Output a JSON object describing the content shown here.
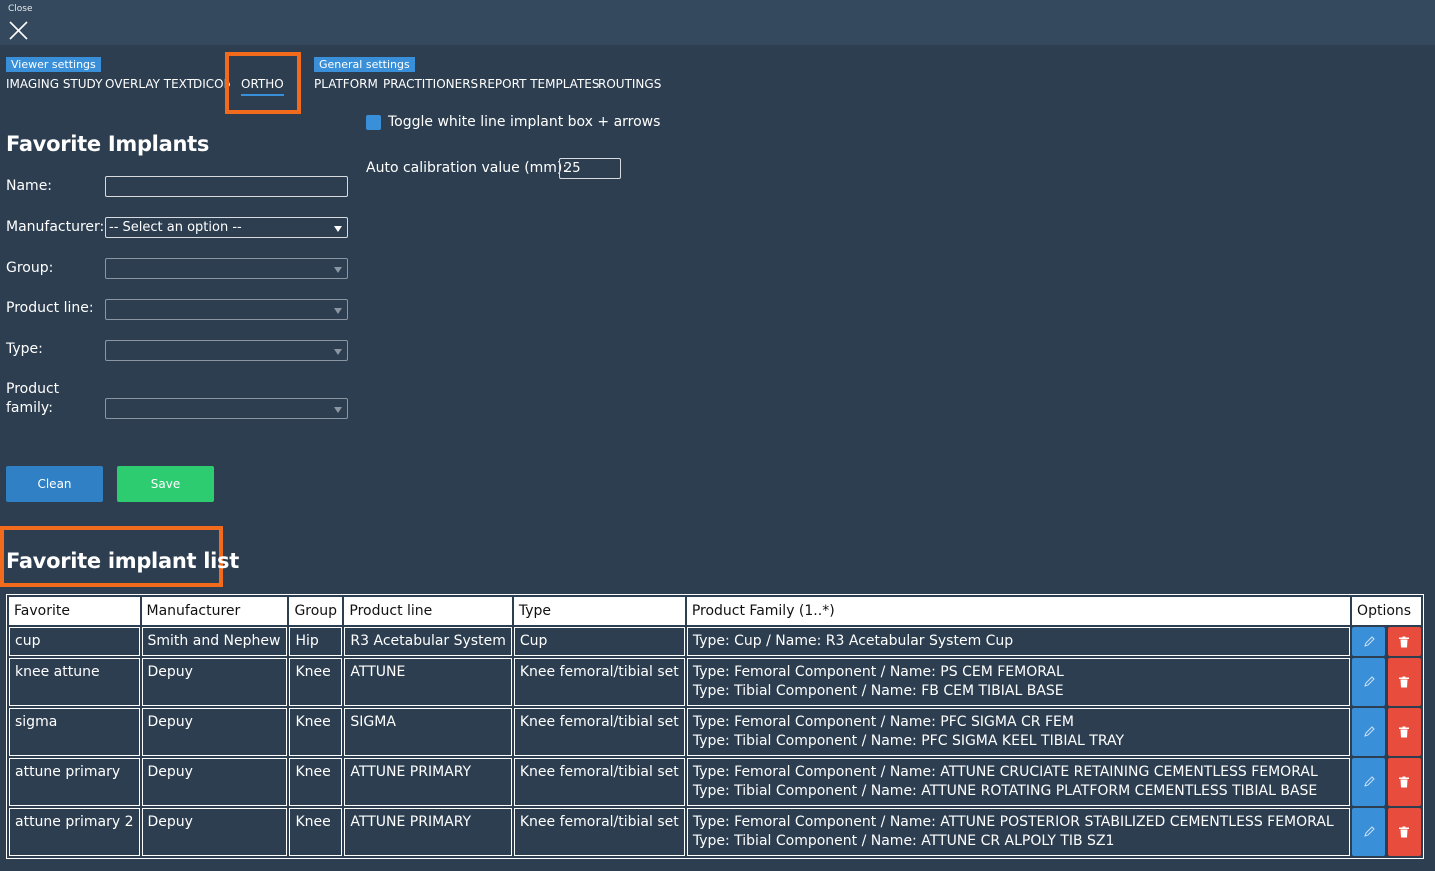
{
  "topbar": {
    "close_label": "Close"
  },
  "tabs": {
    "viewer_group": "Viewer settings",
    "general_group": "General settings",
    "viewer_tabs": [
      "IMAGING STUDY",
      "OVERLAY TEXT",
      "DICOM",
      "ORTHO"
    ],
    "general_tabs": [
      "PLATFORM",
      "PRACTITIONERS",
      "REPORT TEMPLATES",
      "ROUTINGS"
    ],
    "active": "ORTHO"
  },
  "form": {
    "title": "Favorite Implants",
    "name_label": "Name:",
    "name_value": "",
    "manufacturer_label": "Manufacturer:",
    "manufacturer_value": "-- Select an option --",
    "group_label": "Group:",
    "product_line_label": "Product line:",
    "type_label": "Type:",
    "product_family_label_1": "Product",
    "product_family_label_2": "family:",
    "clean_label": "Clean",
    "save_label": "Save"
  },
  "settings": {
    "toggle_label": "Toggle white line implant box + arrows",
    "toggle_checked": true,
    "calibration_label": "Auto calibration value (mm):",
    "calibration_value": "25"
  },
  "list": {
    "title": "Favorite implant list",
    "headers": [
      "Favorite",
      "Manufacturer",
      "Group",
      "Product line",
      "Type",
      "Product Family (1..*)",
      "Options"
    ],
    "rows": [
      {
        "favorite": "cup",
        "manufacturer": "Smith and Nephew",
        "group": "Hip",
        "product_line": "R3 Acetabular System",
        "type": "Cup",
        "family_1": "Type: Cup / Name: R3 Acetabular System Cup",
        "family_2": ""
      },
      {
        "favorite": "knee attune",
        "manufacturer": "Depuy",
        "group": "Knee",
        "product_line": "ATTUNE",
        "type": "Knee femoral/tibial set",
        "family_1": "Type: Femoral Component / Name: PS CEM FEMORAL",
        "family_2": "Type: Tibial Component / Name: FB CEM TIBIAL BASE"
      },
      {
        "favorite": "sigma",
        "manufacturer": "Depuy",
        "group": "Knee",
        "product_line": "SIGMA",
        "type": "Knee femoral/tibial set",
        "family_1": "Type: Femoral Component / Name: PFC SIGMA CR FEM",
        "family_2": "Type: Tibial Component / Name: PFC SIGMA KEEL TIBIAL TRAY"
      },
      {
        "favorite": "attune primary",
        "manufacturer": "Depuy",
        "group": "Knee",
        "product_line": "ATTUNE PRIMARY",
        "type": "Knee femoral/tibial set",
        "family_1": "Type: Femoral Component / Name: ATTUNE CRUCIATE RETAINING CEMENTLESS FEMORAL",
        "family_2": "Type: Tibial Component / Name: ATTUNE ROTATING PLATFORM CEMENTLESS TIBIAL BASE"
      },
      {
        "favorite": "attune primary 2",
        "manufacturer": "Depuy",
        "group": "Knee",
        "product_line": "ATTUNE PRIMARY",
        "type": "Knee femoral/tibial set",
        "family_1": "Type: Femoral Component / Name: ATTUNE POSTERIOR STABILIZED CEMENTLESS FEMORAL",
        "family_2": "Type: Tibial Component / Name: ATTUNE CR ALPOLY TIB SZ1"
      }
    ]
  },
  "icons": {
    "close": "close-icon",
    "edit": "pencil-icon",
    "delete": "trash-icon"
  },
  "colors": {
    "background": "#2c3e50",
    "accent": "#3a8fd9",
    "save": "#2ecc71",
    "delete": "#e74c3c",
    "highlight": "#f26a1b"
  }
}
